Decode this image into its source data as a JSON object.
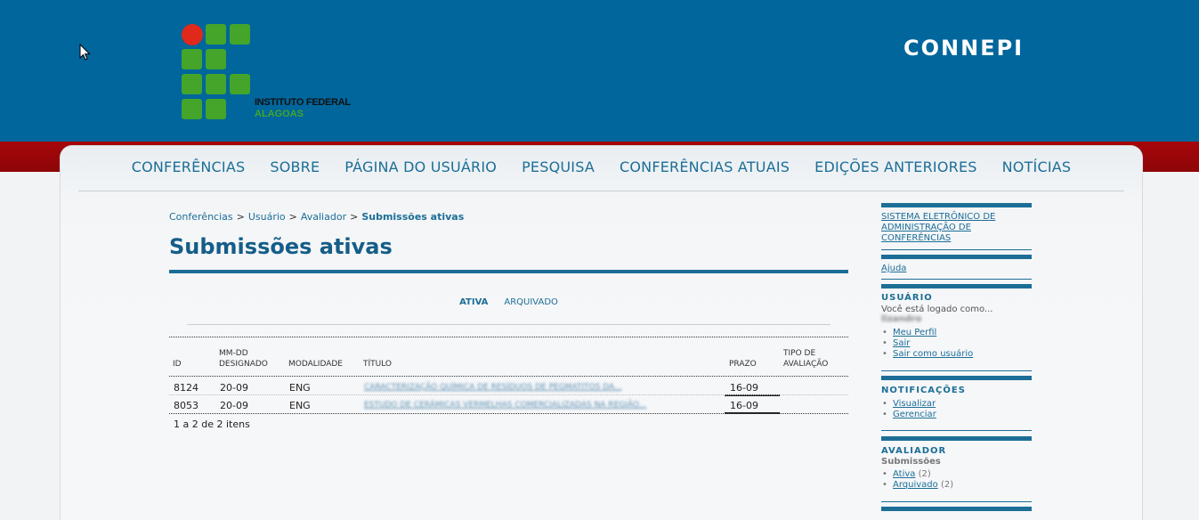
{
  "header": {
    "site_title": "CONNEPI",
    "logo": {
      "line1": "INSTITUTO FEDERAL",
      "line2": "ALAGOAS"
    }
  },
  "nav": {
    "items": [
      "CONFERÊNCIAS",
      "SOBRE",
      "PÁGINA DO USUÁRIO",
      "PESQUISA",
      "CONFERÊNCIAS ATUAIS",
      "EDIÇÕES ANTERIORES",
      "NOTÍCIAS"
    ]
  },
  "breadcrumb": {
    "items": [
      "Conferências",
      "Usuário",
      "Avaliador"
    ],
    "separator": ">",
    "current": "Submissões ativas"
  },
  "page_title": "Submissões ativas",
  "tabs": {
    "active": "ATIVA",
    "archived": "ARQUIVADO"
  },
  "table": {
    "headers": {
      "id": "ID",
      "designado": [
        "MM-DD",
        "DESIGNADO"
      ],
      "modalidade": "MODALIDADE",
      "titulo": "TÍTULO",
      "prazo": "PRAZO",
      "tipo": [
        "TIPO DE",
        "AVALIAÇÃO"
      ]
    },
    "rows": [
      {
        "id": "8124",
        "designado": "20-09",
        "modalidade": "ENG",
        "titulo": "CARACTERIZAÇÃO QUÍMICA DE RESÍDUOS DE PEGMATITOS DA...",
        "prazo": "16-09"
      },
      {
        "id": "8053",
        "designado": "20-09",
        "modalidade": "ENG",
        "titulo": "ESTUDO DE CERÂMICAS VERMELHAS COMERCIALIZADAS NA REGIÃO...",
        "prazo": "16-09"
      }
    ],
    "count": "1 a 2 de 2 itens"
  },
  "sidebar": {
    "system_link": "SISTEMA ELETRÔNICO DE ADMINISTRAÇÃO DE CONFERÊNCIAS",
    "help": "Ajuda",
    "user": {
      "title": "USUÁRIO",
      "logged_as": "Você está logado como...",
      "username": "lizandro",
      "links": [
        "Meu Perfil",
        "Sair",
        "Sair como usuário"
      ]
    },
    "notifications": {
      "title": "NOTIFICAÇÕES",
      "links": [
        "Visualizar",
        "Gerenciar"
      ]
    },
    "reviewer": {
      "title": "AVALIADOR",
      "subtitle": "Submissões",
      "links": [
        {
          "label": "Ativa",
          "count": "(2)"
        },
        {
          "label": "Arquivado",
          "count": "(2)"
        }
      ]
    }
  },
  "colors": {
    "header_bg": "#00669c",
    "band_red": "#a6060a",
    "accent": "#1c6e96",
    "logo_green": "#44a52a",
    "logo_red": "#e0281b"
  }
}
